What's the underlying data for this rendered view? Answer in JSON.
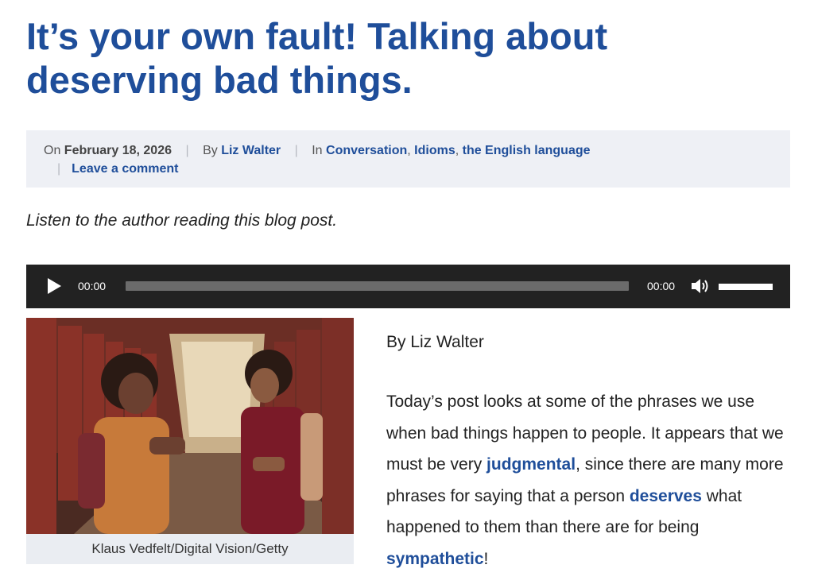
{
  "post": {
    "title": "It’s your own fault! Talking about deserving bad things."
  },
  "meta": {
    "on_label": "On",
    "date": "February 18, 2026",
    "by_label": "By",
    "author": "Liz Walter",
    "in_label": "In",
    "categories": [
      "Conversation",
      "Idioms",
      "the English language"
    ],
    "comment_link": "Leave a comment"
  },
  "audio": {
    "listen_text": "Listen to the author reading this blog post.",
    "current_time": "00:00",
    "duration": "00:00",
    "progress": 0,
    "volume": 1
  },
  "figure": {
    "caption": "Klaus Vedfelt/Digital Vision/Getty"
  },
  "article": {
    "byline": "By Liz Walter",
    "intro": {
      "t1": "Today’s post looks at some of the phrases we use when bad things happen to people. It appears that we must be very ",
      "link1": "judgmental",
      "t2": ", since there are many more phrases for saying that a person ",
      "link2": "deserves",
      "t3": " what happened to them than there are for being ",
      "link3": "sympathetic",
      "t4": "!"
    }
  },
  "colors": {
    "link": "#1f4e9a",
    "meta_background": "#eef0f5",
    "player_background": "#222222"
  },
  "icons": [
    "play-icon",
    "mute-icon"
  ]
}
